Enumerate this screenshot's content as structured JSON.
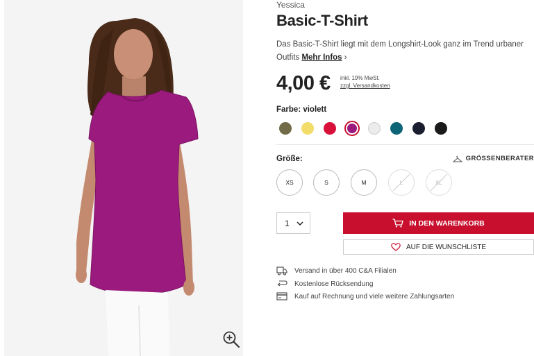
{
  "product": {
    "brand": "Yessica",
    "title": "Basic-T-Shirt",
    "description": "Das Basic-T-Shirt liegt mit dem Longshirt-Look ganz im Trend urbaner Outfits",
    "more_info": "Mehr Infos",
    "price": "4,00 €",
    "tax_note": "inkl. 19% MwSt.",
    "shipping_link": "zzgl. Versandkosten"
  },
  "colors": {
    "label": "Farbe: violett",
    "selected_index": 3,
    "swatches": [
      {
        "name": "olive",
        "hex": "#716b47"
      },
      {
        "name": "yellow",
        "hex": "#f2dc6a"
      },
      {
        "name": "red",
        "hex": "#d8103a"
      },
      {
        "name": "violett",
        "hex": "#9b1a7e"
      },
      {
        "name": "white",
        "hex": "#ececec"
      },
      {
        "name": "petrol",
        "hex": "#0e6477"
      },
      {
        "name": "navy",
        "hex": "#1b1e2e"
      },
      {
        "name": "black",
        "hex": "#1a1a1a"
      }
    ]
  },
  "sizes": {
    "label": "Größe:",
    "guide": "GRÖSSENBERATER",
    "options": [
      {
        "label": "XS",
        "available": true
      },
      {
        "label": "S",
        "available": true
      },
      {
        "label": "M",
        "available": true
      },
      {
        "label": "L",
        "available": false
      },
      {
        "label": "XL",
        "available": false
      }
    ]
  },
  "purchase": {
    "quantity": "1",
    "add_to_cart": "IN DEN WARENKORB",
    "wishlist": "AUF DIE WUNSCHLISTE"
  },
  "features": [
    {
      "icon": "truck-icon",
      "text": "Versand in über 400 C&A Filialen"
    },
    {
      "icon": "return-icon",
      "text": "Kostenlose Rücksendung"
    },
    {
      "icon": "credit-card-icon",
      "text": "Kauf auf Rechnung und viele weitere Zahlungsarten"
    }
  ],
  "theme": {
    "accent": "#c8102e",
    "shirt": "#9b1a7e"
  }
}
